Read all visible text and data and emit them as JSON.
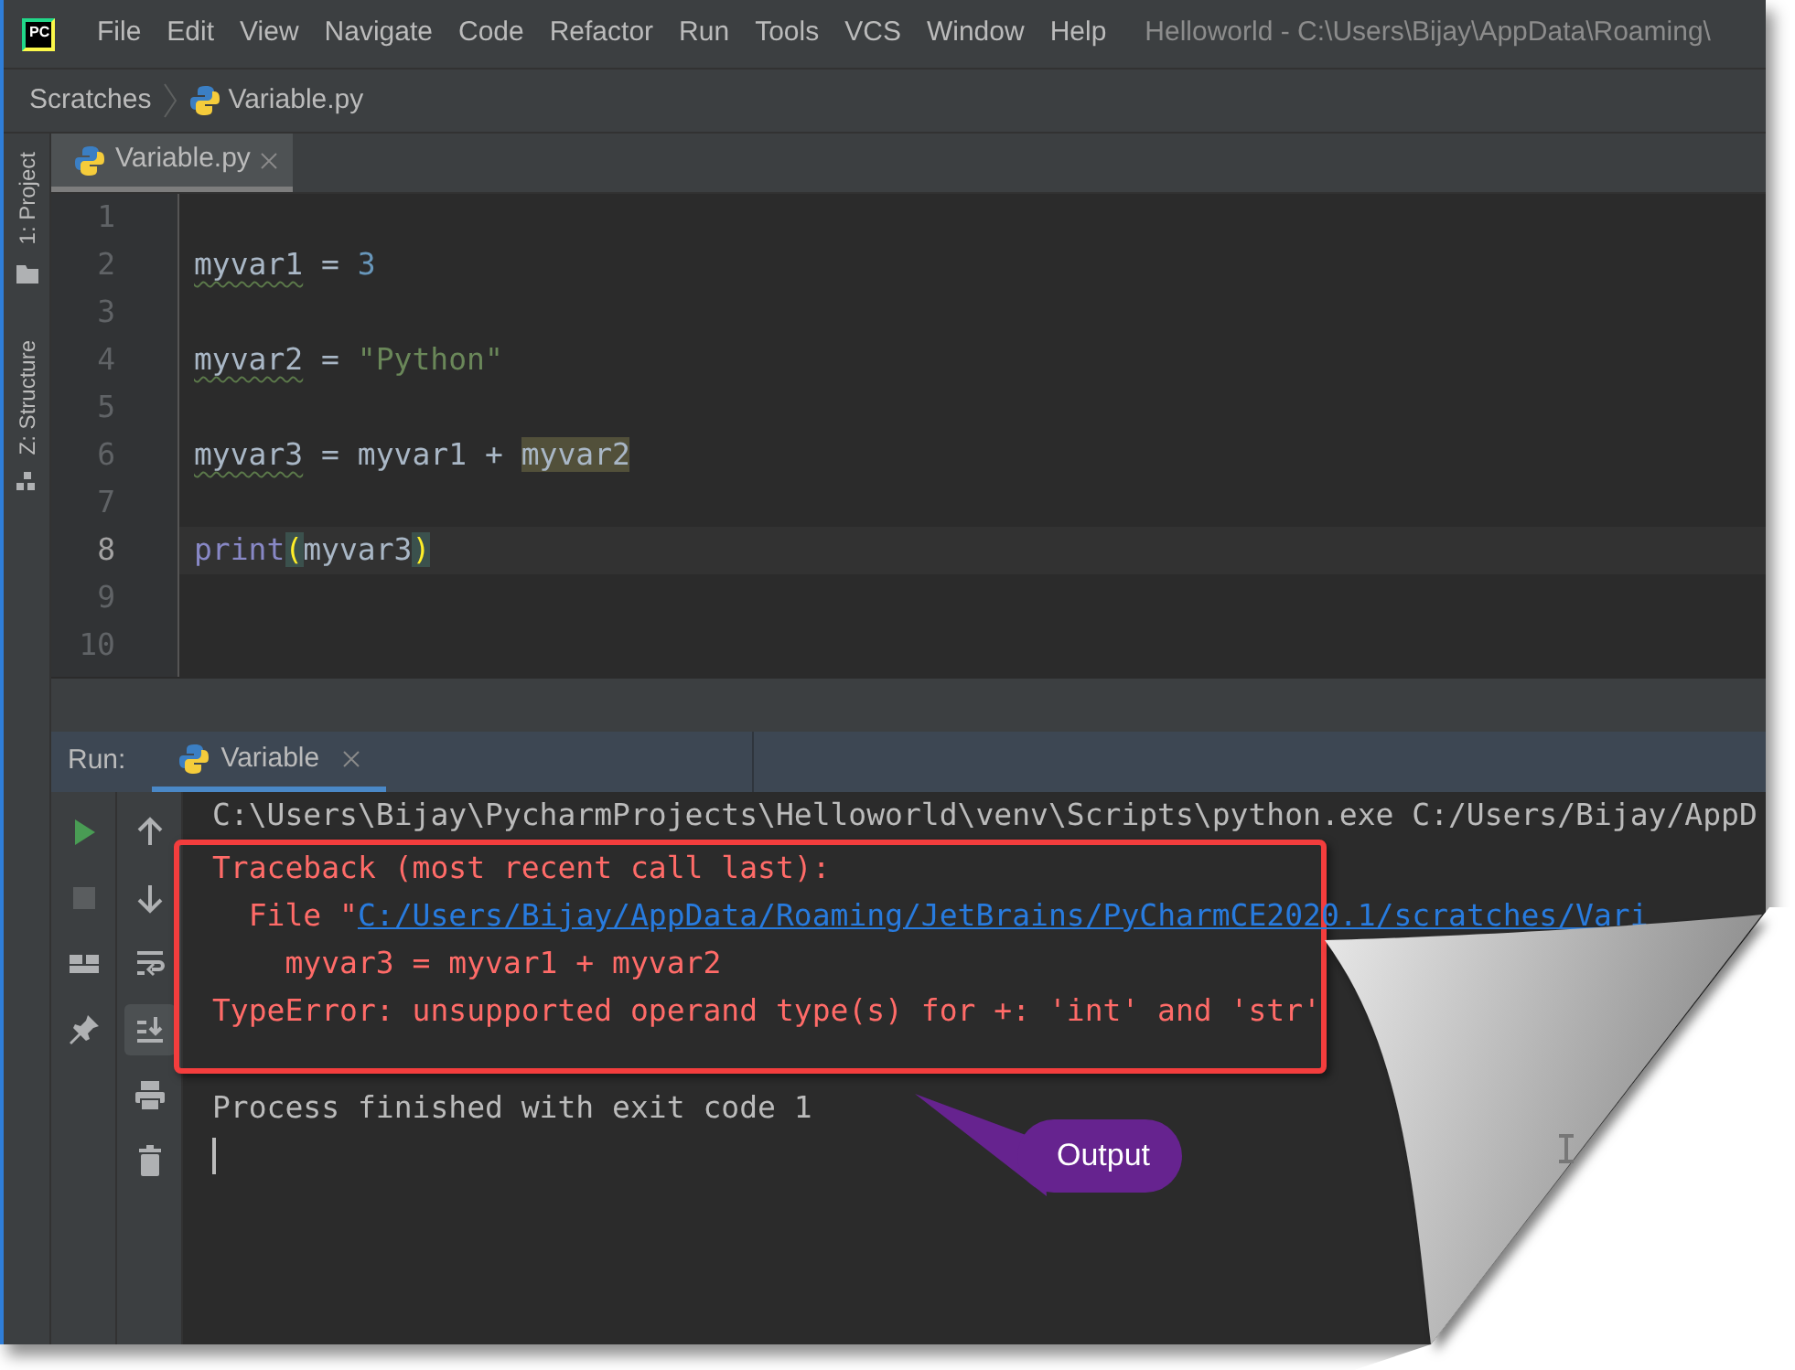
{
  "window": {
    "logo": "PC",
    "title": "Helloworld - C:\\Users\\Bijay\\AppData\\Roaming\\"
  },
  "menu": [
    "File",
    "Edit",
    "View",
    "Navigate",
    "Code",
    "Refactor",
    "Run",
    "Tools",
    "VCS",
    "Window",
    "Help"
  ],
  "breadcrumb": [
    "Scratches",
    "Variable.py"
  ],
  "side_tabs": [
    {
      "label": "1: Project",
      "kind": "project"
    },
    {
      "label": "Z: Structure",
      "kind": "structure"
    }
  ],
  "editor_tabs": [
    {
      "label": "Variable.py",
      "selected": true
    }
  ],
  "editor": {
    "lines": [
      {
        "number": "1",
        "current": false
      },
      {
        "number": "2",
        "current": false,
        "tokens": [
          {
            "text": "myvar1",
            "kind": "warn-name"
          },
          {
            "text": " = ",
            "kind": "plain"
          },
          {
            "text": "3",
            "kind": "number"
          }
        ]
      },
      {
        "number": "3",
        "current": false
      },
      {
        "number": "4",
        "current": false,
        "tokens": [
          {
            "text": "myvar2",
            "kind": "warn-name"
          },
          {
            "text": " = ",
            "kind": "plain"
          },
          {
            "text": "\"Python\"",
            "kind": "string"
          }
        ]
      },
      {
        "number": "5",
        "current": false
      },
      {
        "number": "6",
        "current": false,
        "tokens": [
          {
            "text": "myvar3",
            "kind": "warn-name"
          },
          {
            "text": " = myvar1 + ",
            "kind": "plain"
          },
          {
            "text": "myvar2",
            "kind": "usage"
          }
        ]
      },
      {
        "number": "7",
        "current": false
      },
      {
        "number": "8",
        "current": true,
        "tokens": [
          {
            "text": "print",
            "kind": "builtin"
          },
          {
            "text": "(",
            "kind": "brace"
          },
          {
            "text": "myvar3",
            "kind": "plain"
          },
          {
            "text": ")",
            "kind": "brace"
          }
        ]
      },
      {
        "number": "9",
        "current": false
      },
      {
        "number": "10",
        "current": false
      }
    ]
  },
  "run_panel": {
    "label": "Run:",
    "tabs": [
      {
        "label": "Variable",
        "selected": true
      }
    ],
    "left_tools": [
      {
        "kind": "run"
      },
      {
        "kind": "stop"
      },
      {
        "kind": "layout"
      },
      {
        "kind": "pin"
      }
    ],
    "right_tools": [
      {
        "kind": "up",
        "selected": false
      },
      {
        "kind": "down",
        "selected": false
      },
      {
        "kind": "wrap",
        "selected": false
      },
      {
        "kind": "scroll-end",
        "selected": true
      },
      {
        "kind": "print",
        "selected": false
      },
      {
        "kind": "trash",
        "selected": false
      }
    ],
    "console": [
      {
        "kind": "plain",
        "lines": [
          {
            "text": "C:\\Users\\Bijay\\PycharmProjects\\Helloworld\\venv\\Scripts\\python.exe C:/Users/Bijay/AppD"
          }
        ]
      },
      {
        "kind": "error-frame",
        "lines": [
          {
            "text": "Traceback (most recent call last):"
          },
          {
            "text": "  File \"",
            "link": "C:/Users/Bijay/AppData/Roaming/JetBrains/PyCharmCE2020.1/scratches/Vari"
          },
          {
            "text": "    myvar3 = myvar1 + myvar2"
          },
          {
            "text": "TypeError: unsupported operand type(s) for +: 'int' and 'str'"
          }
        ]
      },
      {
        "kind": "plain",
        "lines": [
          {
            "text": "Process finished with exit code 1"
          }
        ]
      }
    ],
    "input_cursor": true
  },
  "annotation": {
    "text": "Output"
  }
}
